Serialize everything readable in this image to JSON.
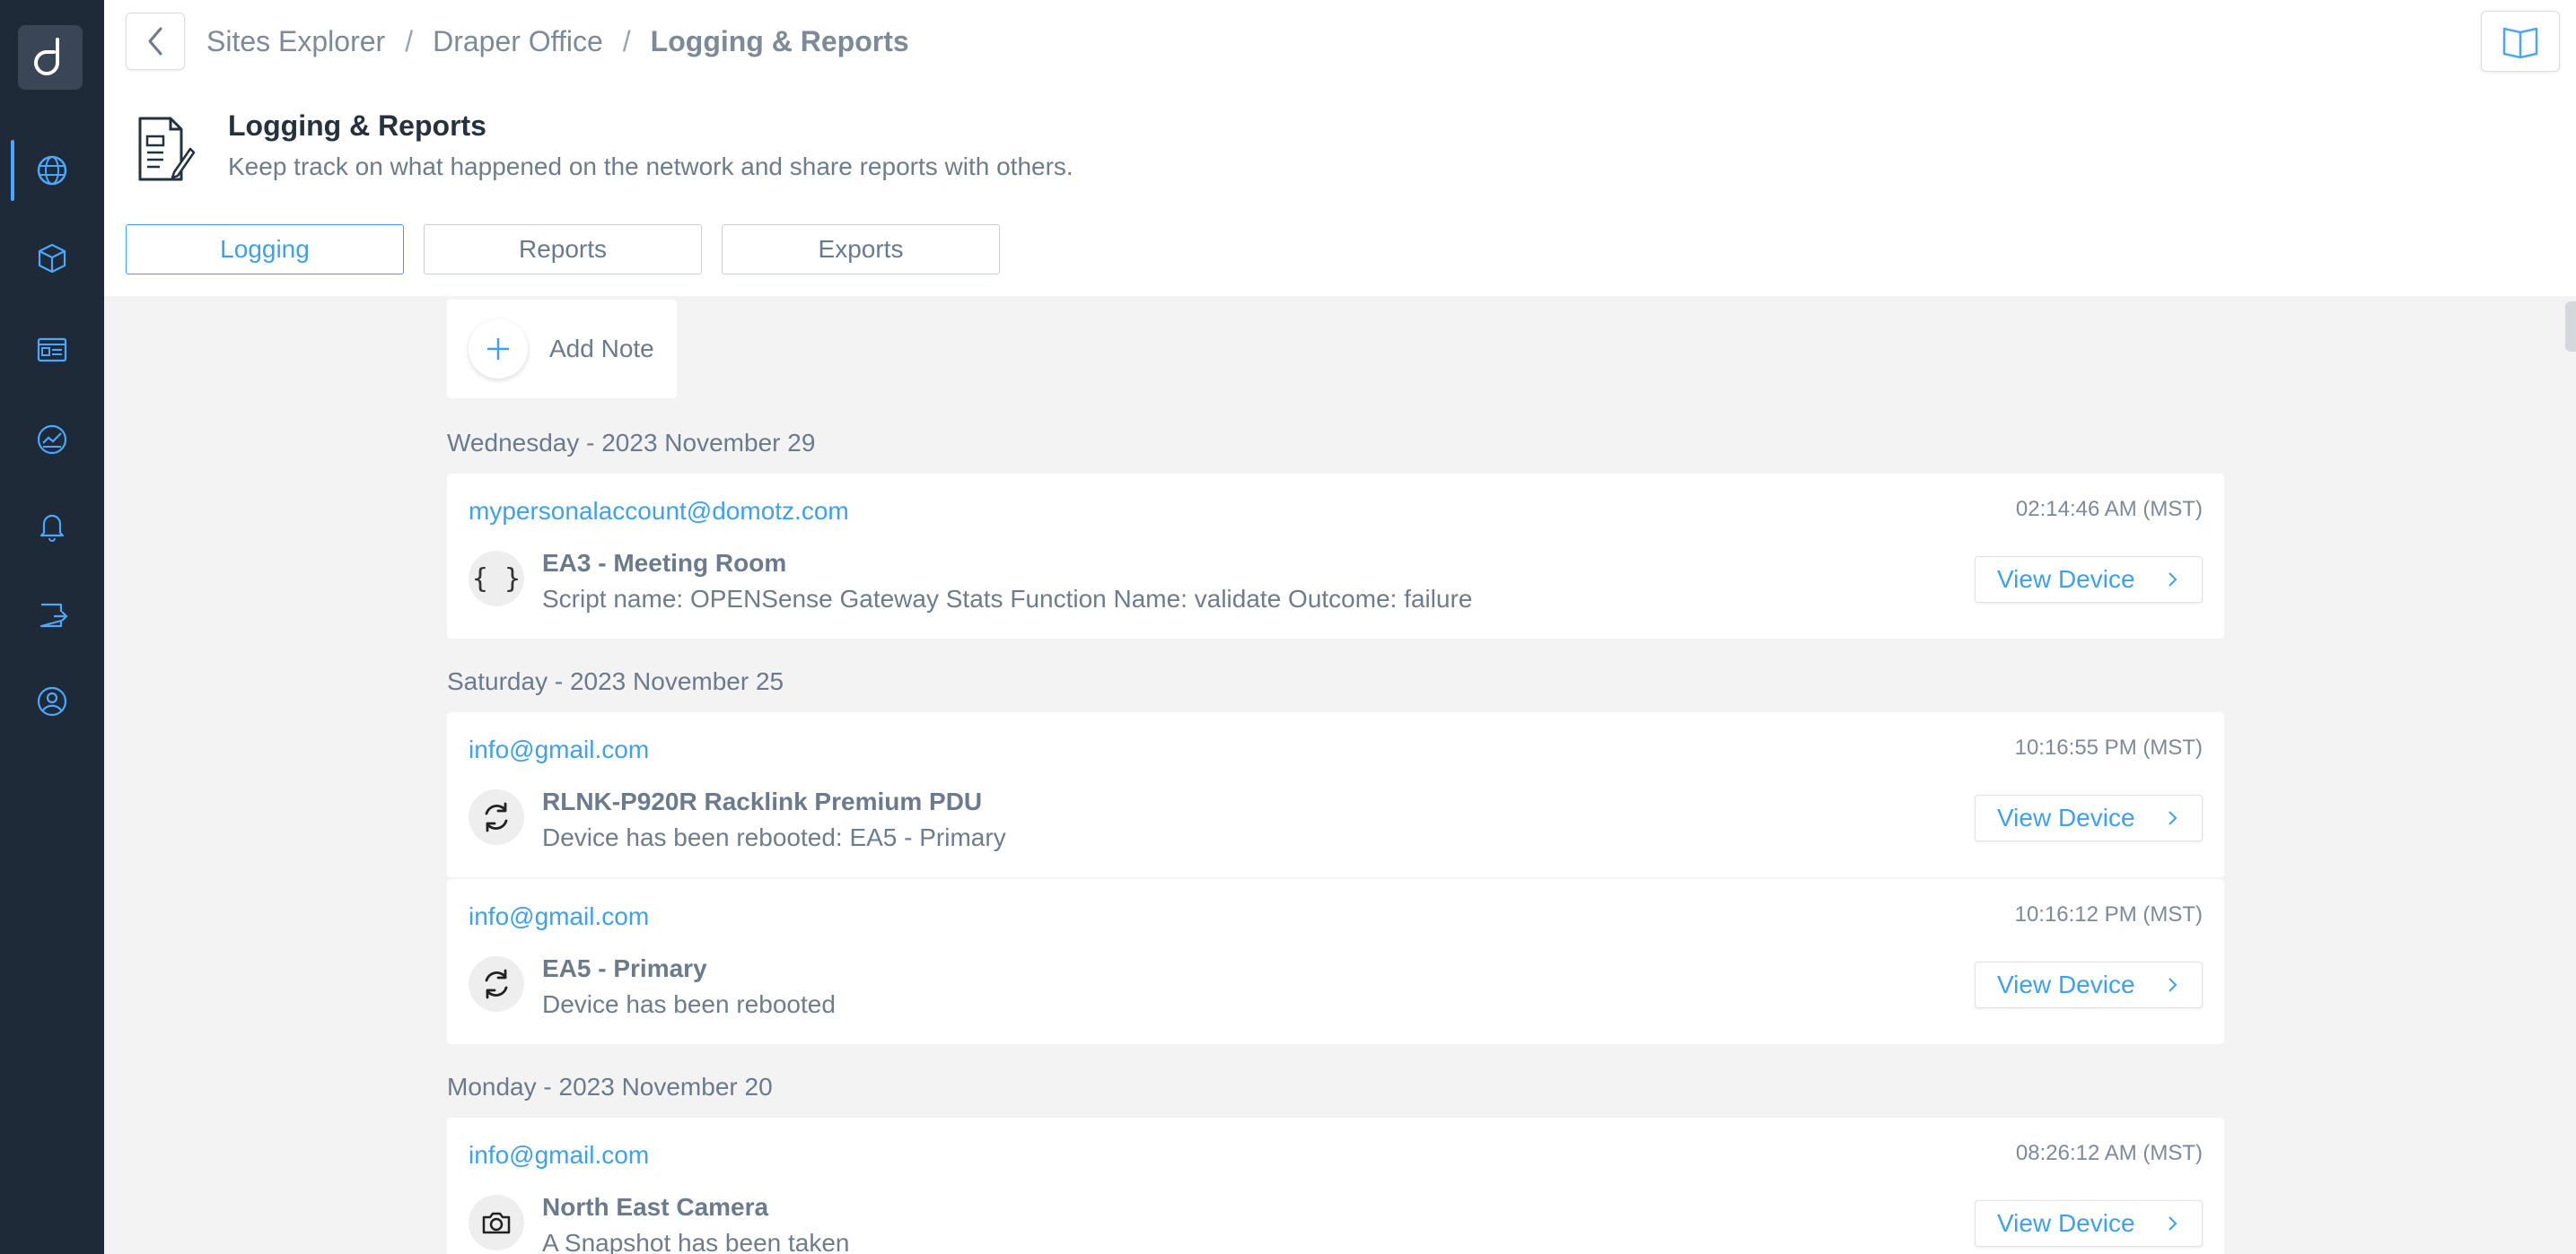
{
  "breadcrumb": {
    "items": [
      "Sites Explorer",
      "Draper Office",
      "Logging & Reports"
    ],
    "separator": "/"
  },
  "header": {
    "title": "Logging & Reports",
    "subtitle": "Keep track on what happened on the network and share reports with others."
  },
  "tabs": [
    {
      "label": "Logging",
      "active": true
    },
    {
      "label": "Reports",
      "active": false
    },
    {
      "label": "Exports",
      "active": false
    }
  ],
  "add_note": {
    "label": "Add Note"
  },
  "days": [
    {
      "label": "Wednesday - 2023 November 29"
    },
    {
      "label": "Saturday - 2023 November 25"
    },
    {
      "label": "Monday - 2023 November 20"
    }
  ],
  "entries": [
    {
      "user": "mypersonalaccount@domotz.com",
      "time": "02:14:46 AM (MST)",
      "icon": "script-braces-icon",
      "icon_text": "{ }",
      "name": "EA3 - Meeting Room",
      "desc": "Script name: OPENSense Gateway Stats Function Name: validate Outcome: failure",
      "button": "View Device"
    },
    {
      "user": "info@gmail.com",
      "time": "10:16:55 PM (MST)",
      "icon": "reboot-icon",
      "icon_text": "",
      "name": "RLNK-P920R Racklink Premium PDU",
      "desc": "Device has been rebooted: EA5 - Primary",
      "button": "View Device"
    },
    {
      "user": "info@gmail.com",
      "time": "10:16:12 PM (MST)",
      "icon": "reboot-icon",
      "icon_text": "",
      "name": "EA5 - Primary",
      "desc": "Device has been rebooted",
      "button": "View Device"
    },
    {
      "user": "info@gmail.com",
      "time": "08:26:12 AM (MST)",
      "icon": "camera-icon",
      "icon_text": "",
      "name": "North East Camera",
      "desc": "A Snapshot has been taken",
      "button": "View Device"
    }
  ],
  "colors": {
    "sidebar_bg": "#1e2a38",
    "accent": "#3fa0f0",
    "content_bg": "#f3f3f3"
  },
  "sidebar": {
    "logo": "domotz-logo",
    "items": [
      "network-globe-icon",
      "devices-cube-icon",
      "dashboard-card-icon",
      "monitoring-gauge-icon",
      "alerts-bell-icon",
      "integrations-icon",
      "account-user-icon"
    ]
  }
}
